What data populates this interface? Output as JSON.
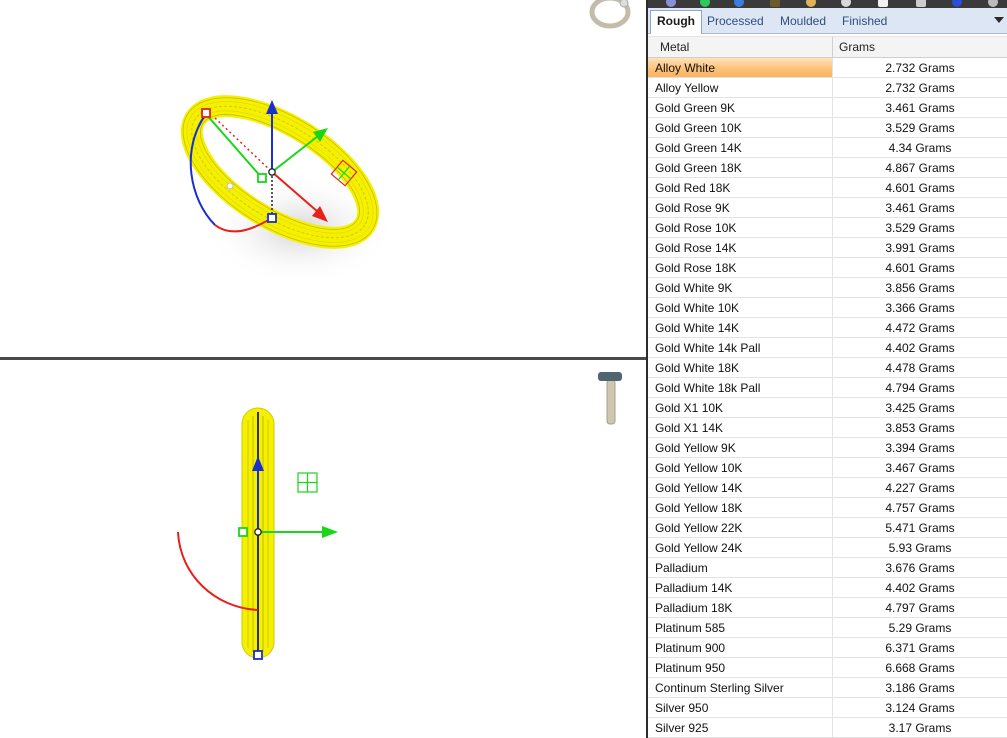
{
  "tabs": [
    {
      "label": "Rough",
      "active": true
    },
    {
      "label": "Processed",
      "active": false
    },
    {
      "label": "Moulded",
      "active": false
    },
    {
      "label": "Finished",
      "active": false
    }
  ],
  "table": {
    "columns": [
      "Metal",
      "Grams"
    ],
    "selected_index": 0,
    "rows": [
      {
        "metal": "Alloy White",
        "grams": "2.732 Grams"
      },
      {
        "metal": "Alloy Yellow",
        "grams": "2.732 Grams"
      },
      {
        "metal": "Gold Green 9K",
        "grams": "3.461 Grams"
      },
      {
        "metal": "Gold Green 10K",
        "grams": "3.529 Grams"
      },
      {
        "metal": "Gold Green 14K",
        "grams": "4.34 Grams"
      },
      {
        "metal": "Gold Green 18K",
        "grams": "4.867 Grams"
      },
      {
        "metal": "Gold Red 18K",
        "grams": "4.601 Grams"
      },
      {
        "metal": "Gold Rose 9K",
        "grams": "3.461 Grams"
      },
      {
        "metal": "Gold Rose 10K",
        "grams": "3.529 Grams"
      },
      {
        "metal": "Gold Rose 14K",
        "grams": "3.991 Grams"
      },
      {
        "metal": "Gold Rose 18K",
        "grams": "4.601 Grams"
      },
      {
        "metal": "Gold White 9K",
        "grams": "3.856 Grams"
      },
      {
        "metal": "Gold White 10K",
        "grams": "3.366 Grams"
      },
      {
        "metal": "Gold White 14K",
        "grams": "4.472 Grams"
      },
      {
        "metal": "Gold White 14k Pall",
        "grams": "4.402 Grams"
      },
      {
        "metal": "Gold White 18K",
        "grams": "4.478 Grams"
      },
      {
        "metal": "Gold White 18k Pall",
        "grams": "4.794 Grams"
      },
      {
        "metal": "Gold X1 10K",
        "grams": "3.425 Grams"
      },
      {
        "metal": "Gold X1 14K",
        "grams": "3.853 Grams"
      },
      {
        "metal": "Gold Yellow 9K",
        "grams": "3.394 Grams"
      },
      {
        "metal": "Gold Yellow 10K",
        "grams": "3.467 Grams"
      },
      {
        "metal": "Gold Yellow 14K",
        "grams": "4.227 Grams"
      },
      {
        "metal": "Gold Yellow 18K",
        "grams": "4.757 Grams"
      },
      {
        "metal": "Gold Yellow 22K",
        "grams": "5.471 Grams"
      },
      {
        "metal": "Gold Yellow 24K",
        "grams": "5.93 Grams"
      },
      {
        "metal": "Palladium",
        "grams": "3.676 Grams"
      },
      {
        "metal": "Palladium 14K",
        "grams": "4.402 Grams"
      },
      {
        "metal": "Palladium 18K",
        "grams": "4.797 Grams"
      },
      {
        "metal": "Platinum 585",
        "grams": "5.29 Grams"
      },
      {
        "metal": "Platinum 900",
        "grams": "6.371 Grams"
      },
      {
        "metal": "Platinum 950",
        "grams": "6.668 Grams"
      },
      {
        "metal": "Continum Sterling Silver",
        "grams": "3.186 Grams"
      },
      {
        "metal": "Silver 950",
        "grams": "3.124 Grams"
      },
      {
        "metal": "Silver 925",
        "grams": "3.17 Grams"
      }
    ]
  },
  "colors": {
    "ring": "#f5f000",
    "ring_line": "#d4c800",
    "axis_x": "#e8201a",
    "axis_y": "#19d619",
    "axis_z": "#1a2fd0",
    "selection": "#ffc27a"
  },
  "icons": [
    "ring-view-icon",
    "side-view-icon",
    "grid-snap-icon",
    "gumball-icon"
  ]
}
